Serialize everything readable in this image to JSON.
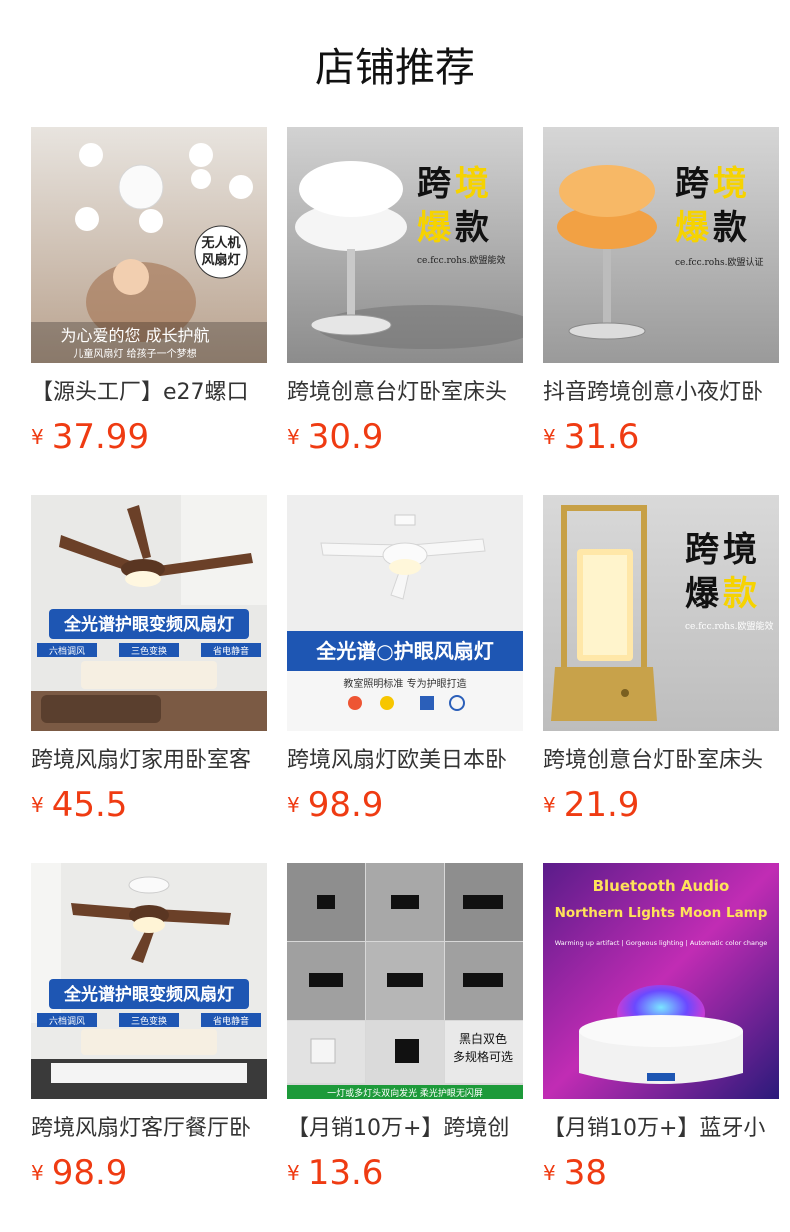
{
  "section_title": "店铺推荐",
  "products": [
    {
      "name": "【源头工厂】e27螺口",
      "currency": "¥",
      "price": "37.99",
      "image": {
        "icon": "drone-fan-lamp-image",
        "overlay_badge": "无人机\n风扇灯",
        "overlay_line1": "为心爱的您  成长护航",
        "overlay_line2": "儿童风扇灯  给孩子一个梦想"
      }
    },
    {
      "name": "跨境创意台灯卧室床头",
      "currency": "¥",
      "price": "30.9",
      "image": {
        "icon": "white-table-lamp-image",
        "title_a": "跨",
        "title_b": "境",
        "title_c": "爆",
        "title_d": "款",
        "cert": "ce.fcc.rohs.欧盟能效"
      }
    },
    {
      "name": "抖音跨境创意小夜灯卧",
      "currency": "¥",
      "price": "31.6",
      "image": {
        "icon": "orange-table-lamp-image",
        "title_a": "跨",
        "title_b": "境",
        "title_c": "爆",
        "title_d": "款",
        "cert": "ce.fcc.rohs.欧盟认证"
      }
    },
    {
      "name": "跨境风扇灯家用卧室客",
      "currency": "¥",
      "price": "45.5",
      "image": {
        "icon": "brown-ceiling-fan-image",
        "banner": "全光谱护眼变频风扇灯",
        "tag1": "六档调风",
        "tag2": "三色变换",
        "tag3": "省电静音"
      }
    },
    {
      "name": "跨境风扇灯欧美日本卧",
      "currency": "¥",
      "price": "98.9",
      "image": {
        "icon": "white-ceiling-fan-image",
        "banner": "全光谱○护眼风扇灯",
        "sub": "教室照明标准 专为护眼打造"
      }
    },
    {
      "name": "跨境创意台灯卧室床头",
      "currency": "¥",
      "price": "21.9",
      "image": {
        "icon": "gold-lantern-lamp-image",
        "title_a": "跨",
        "title_b": "境",
        "title_c": "爆",
        "title_d": "款",
        "cert": "ce.fcc.rohs.欧盟能效"
      }
    },
    {
      "name": "跨境风扇灯客厅餐厅卧",
      "currency": "¥",
      "price": "98.9",
      "image": {
        "icon": "bedroom-ceiling-fan-image",
        "banner": "全光谱护眼变频风扇灯",
        "tag1": "六档调风",
        "tag2": "三色变换",
        "tag3": "省电静音"
      }
    },
    {
      "name": "【月销10万+】跨境创",
      "currency": "¥",
      "price": "13.6",
      "image": {
        "icon": "wall-lights-grid-image",
        "label1": "黑白双色",
        "label2": "多规格可选",
        "strip": "一灯或多灯头双向发光  柔光护眼无闪屏"
      }
    },
    {
      "name": "【月销10万+】蓝牙小",
      "currency": "¥",
      "price": "38",
      "image": {
        "icon": "bluetooth-moon-lamp-image",
        "line1": "Bluetooth Audio",
        "line2": "Northern Lights Moon Lamp",
        "line3": "Warming up artifact | Gorgeous lighting | Automatic color change"
      }
    }
  ],
  "colors": {
    "price": "#ef3b12",
    "title": "#111111",
    "name": "#333333"
  }
}
